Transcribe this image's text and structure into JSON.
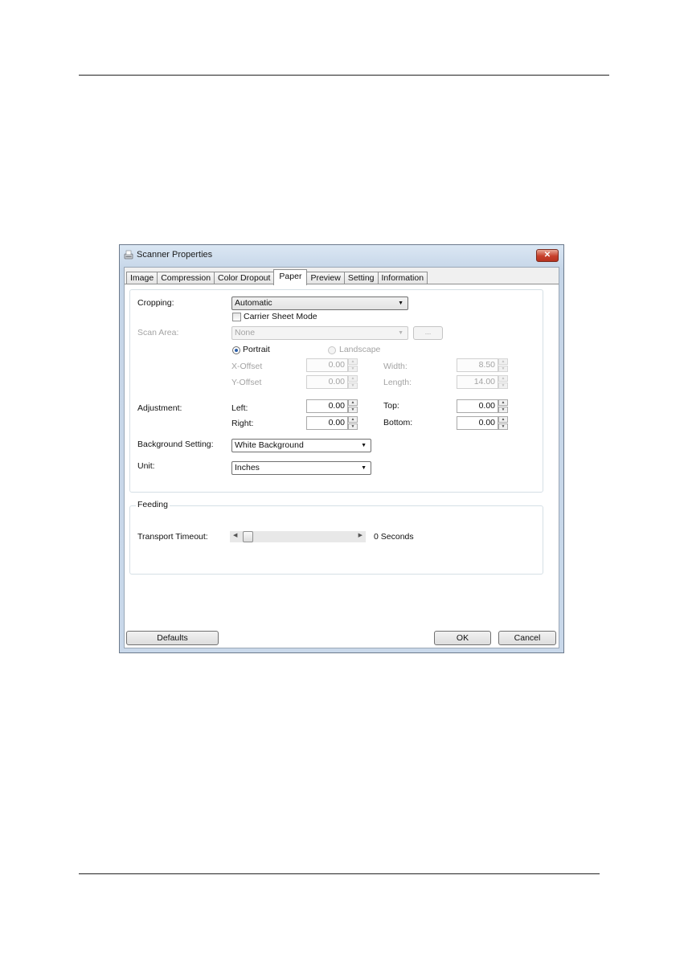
{
  "window": {
    "title": "Scanner Properties",
    "close_glyph": "✕"
  },
  "tabs": [
    {
      "label": "Image"
    },
    {
      "label": "Compression"
    },
    {
      "label": "Color Dropout"
    },
    {
      "label": "Paper"
    },
    {
      "label": "Preview"
    },
    {
      "label": "Setting"
    },
    {
      "label": "Information"
    }
  ],
  "active_tab": "Paper",
  "paper": {
    "cropping": {
      "label": "Cropping:",
      "value": "Automatic"
    },
    "carrier_sheet": {
      "label": "Carrier Sheet Mode",
      "checked": false
    },
    "scan_area": {
      "label": "Scan Area:",
      "value": "None",
      "browse_label": "..."
    },
    "orientation": {
      "portrait": "Portrait",
      "landscape": "Landscape",
      "selected": "Portrait"
    },
    "x_offset": {
      "label": "X-Offset",
      "value": "0.00"
    },
    "y_offset": {
      "label": "Y-Offset",
      "value": "0.00"
    },
    "width": {
      "label": "Width:",
      "value": "8.50"
    },
    "length": {
      "label": "Length:",
      "value": "14.00"
    },
    "adjustment": {
      "label": "Adjustment:",
      "left": {
        "label": "Left:",
        "value": "0.00"
      },
      "right": {
        "label": "Right:",
        "value": "0.00"
      },
      "top": {
        "label": "Top:",
        "value": "0.00"
      },
      "bottom": {
        "label": "Bottom:",
        "value": "0.00"
      }
    },
    "background": {
      "label": "Background Setting:",
      "value": "White Background"
    },
    "unit": {
      "label": "Unit:",
      "value": "Inches"
    }
  },
  "feeding": {
    "title": "Feeding",
    "transport_timeout": {
      "label": "Transport Timeout:",
      "value_text": "0 Seconds",
      "level": 0
    }
  },
  "buttons": {
    "defaults": "Defaults",
    "ok": "OK",
    "cancel": "Cancel"
  }
}
